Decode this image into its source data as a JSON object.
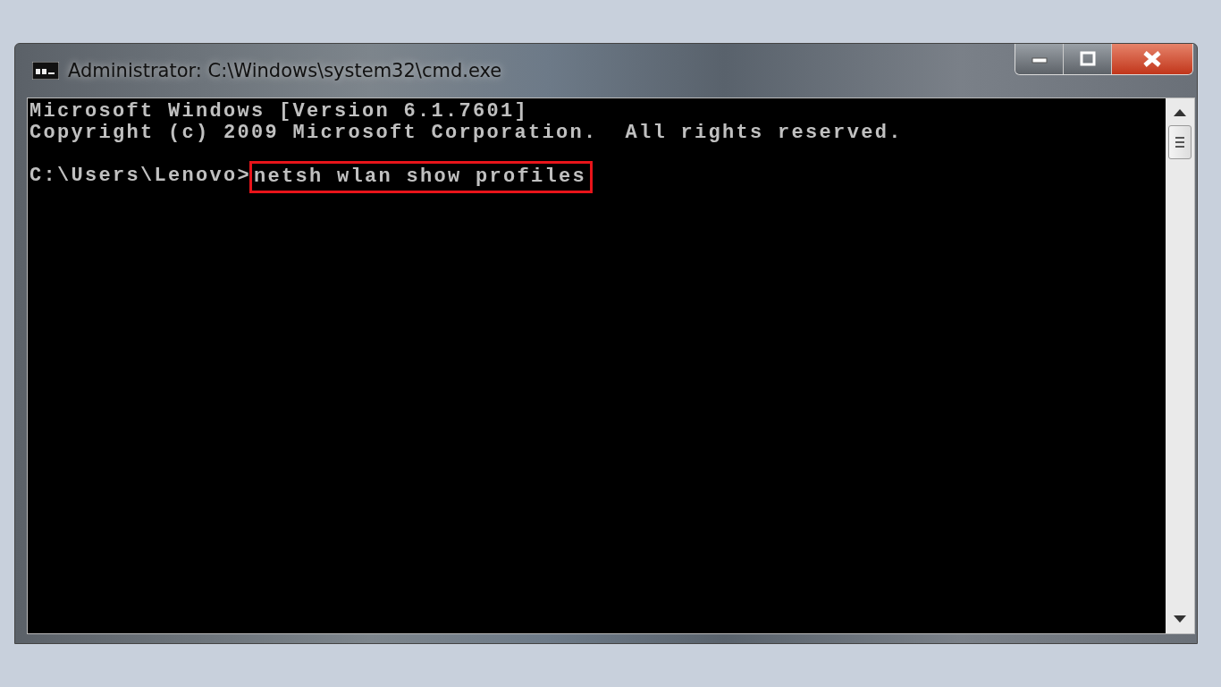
{
  "window": {
    "title": "Administrator: C:\\Windows\\system32\\cmd.exe"
  },
  "console": {
    "lines": [
      {
        "kind": "output",
        "text": "Microsoft Windows [Version 6.1.7601]"
      },
      {
        "kind": "output",
        "text": "Copyright (c) 2009 Microsoft Corporation.  All rights reserved."
      },
      {
        "kind": "blank"
      },
      {
        "kind": "command",
        "prompt": "C:\\Users\\Lenovo>",
        "command": "netsh wlan show profiles",
        "highlighted": true
      }
    ]
  }
}
